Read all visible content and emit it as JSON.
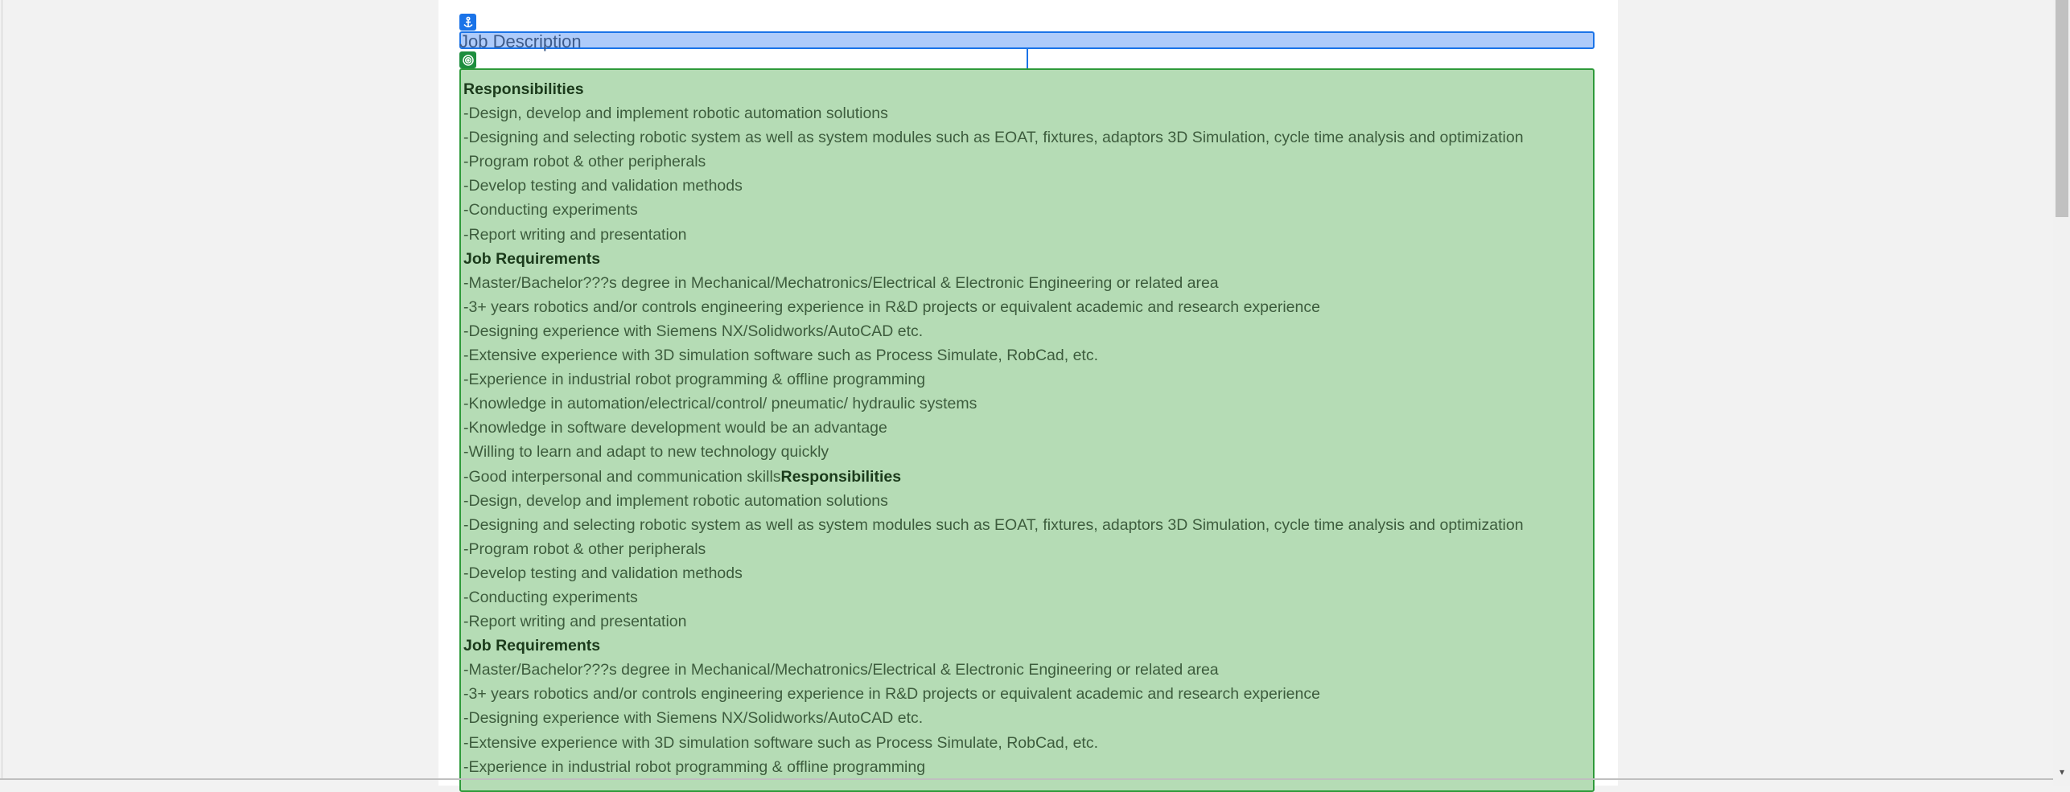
{
  "header": {
    "title": "Job Description",
    "anchor_icon": "anchor-icon",
    "target_icon": "target-icon"
  },
  "content": {
    "lines": [
      {
        "bold": "Responsibilities",
        "text": ""
      },
      {
        "text": "-Design, develop and implement robotic automation solutions"
      },
      {
        "text": "-Designing and selecting robotic system as well as system modules such as EOAT, fixtures, adaptors 3D Simulation, cycle time analysis and optimization"
      },
      {
        "text": "-Program robot & other peripherals"
      },
      {
        "text": "-Develop testing and validation methods"
      },
      {
        "text": "-Conducting experiments"
      },
      {
        "text": "-Report writing and presentation"
      },
      {
        "bold": "Job Requirements",
        "text": ""
      },
      {
        "text": "-Master/Bachelor???s degree in Mechanical/Mechatronics/Electrical & Electronic Engineering or related area"
      },
      {
        "text": "-3+ years robotics and/or controls engineering experience in R&D projects or equivalent academic and research experience"
      },
      {
        "text": "-Designing experience with Siemens NX/Solidworks/AutoCAD etc."
      },
      {
        "text": "-Extensive experience with 3D simulation software such as Process Simulate, RobCad, etc."
      },
      {
        "text": "-Experience in industrial robot programming & offline programming"
      },
      {
        "text": "-Knowledge in automation/electrical/control/ pneumatic/ hydraulic systems"
      },
      {
        "text": "-Knowledge in software development would be an advantage"
      },
      {
        "text": "-Willing to learn and adapt to new technology quickly"
      },
      {
        "text": "-Good interpersonal and communication skills",
        "bold_after": "Responsibilities"
      },
      {
        "text": "-Design, develop and implement robotic automation solutions"
      },
      {
        "text": "-Designing and selecting robotic system as well as system modules such as EOAT, fixtures, adaptors 3D Simulation, cycle time analysis and optimization"
      },
      {
        "text": "-Program robot & other peripherals"
      },
      {
        "text": "-Develop testing and validation methods"
      },
      {
        "text": "-Conducting experiments"
      },
      {
        "text": "-Report writing and presentation"
      },
      {
        "bold": "Job Requirements",
        "text": ""
      },
      {
        "text": "-Master/Bachelor???s degree in Mechanical/Mechatronics/Electrical & Electronic Engineering or related area"
      },
      {
        "text": "-3+ years robotics and/or controls engineering experience in R&D projects or equivalent academic and research experience"
      },
      {
        "text": "-Designing experience with Siemens NX/Solidworks/AutoCAD etc."
      },
      {
        "text": "-Extensive experience with 3D simulation software such as Process Simulate, RobCad, etc."
      },
      {
        "text": "-Experience in industrial robot programming & offline programming"
      }
    ]
  },
  "colors": {
    "header_fill": "#aecbfa",
    "header_border": "#1a73e8",
    "content_fill": "#b5dcb5",
    "content_border": "#2e9a3a"
  }
}
